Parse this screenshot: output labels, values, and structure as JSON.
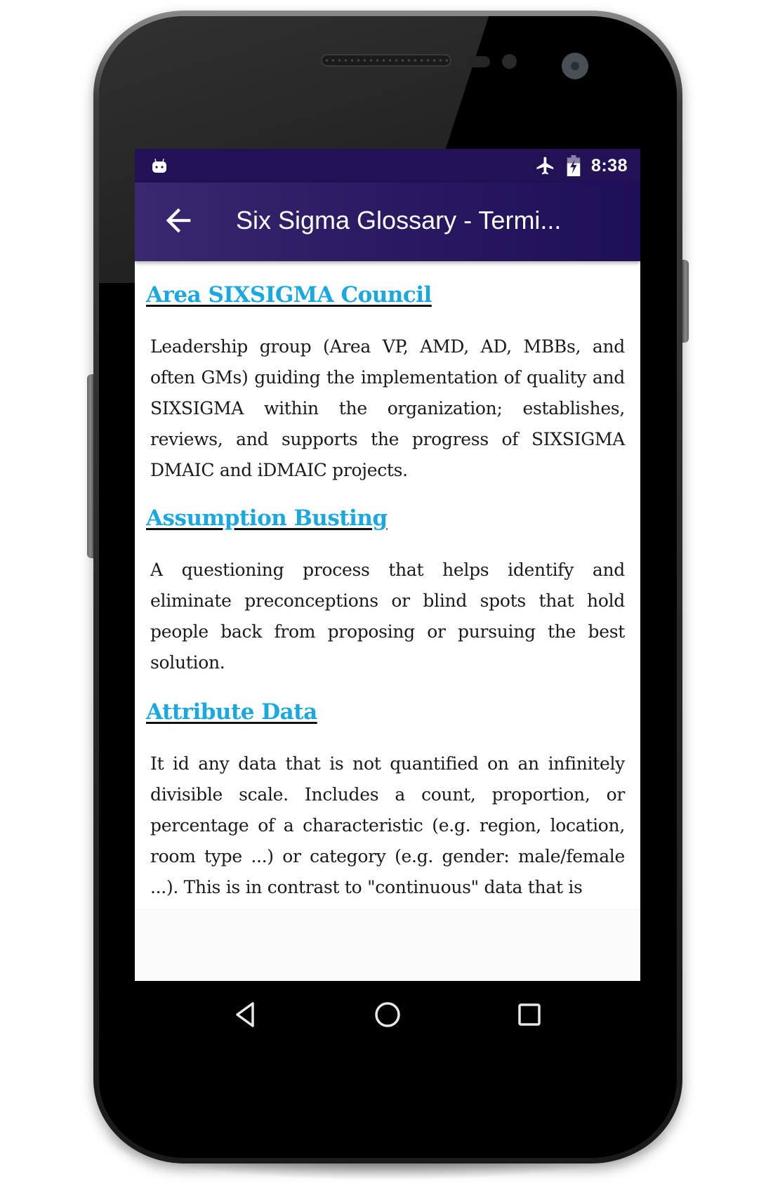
{
  "status_bar": {
    "notification_icon": "android-robot-icon",
    "icons": [
      "airplane-mode-icon",
      "battery-charging-icon"
    ],
    "time": "8:38"
  },
  "app_bar": {
    "back_icon": "arrow-left-icon",
    "title": "Six Sigma Glossary - Termi..."
  },
  "colors": {
    "app_bar": "#2c1a64",
    "status_bar": "#231156",
    "term_link": "#1ba8e0",
    "body_text": "#1a1a1a"
  },
  "glossary": {
    "entries": [
      {
        "term": "Area SIXSIGMA Council",
        "definition": "Leadership group (Area VP, AMD, AD, MBBs, and often GMs) guiding the implementation of quality and SIXSIGMA within the organization; establishes, reviews, and supports the progress of SIXSIGMA DMAIC and iDMAIC projects."
      },
      {
        "term": "Assumption Busting",
        "definition": "A questioning process that helps identify and eliminate preconceptions or blind spots that hold people back from proposing or pursuing the best solution."
      },
      {
        "term": "Attribute Data",
        "definition": "It id any data that is not quantified on an infinitely divisible scale. Includes a count, proportion, or percentage of a characteristic (e.g. region, location, room type ...) or category (e.g. gender: male/female ...). This is in contrast to \"continuous\" data that is"
      }
    ]
  },
  "nav_bar": {
    "buttons": [
      "back",
      "home",
      "recents"
    ]
  }
}
